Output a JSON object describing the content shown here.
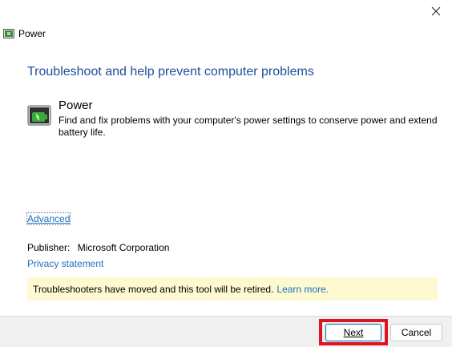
{
  "window": {
    "title": "Power",
    "close_icon": "close-icon",
    "title_icon": "troubleshooter-icon"
  },
  "main": {
    "heading": "Troubleshoot and help prevent computer problems",
    "item": {
      "icon": "power-troubleshooter-icon",
      "title": "Power",
      "description": "Find and fix problems with your computer's power settings to conserve power and extend battery life."
    },
    "advanced_label": "Advanced",
    "publisher_label": "Publisher:",
    "publisher_value": "Microsoft Corporation",
    "privacy_label": "Privacy statement",
    "notice_text": "Troubleshooters have moved and this tool will be retired.",
    "notice_link": "Learn more."
  },
  "footer": {
    "next_label": "Next",
    "cancel_label": "Cancel"
  },
  "colors": {
    "heading": "#1e4e9c",
    "link": "#1e6fbf",
    "notice_bg": "#fdf9d0",
    "highlight": "#e0141e",
    "footer_bg": "#f0f0f0"
  }
}
